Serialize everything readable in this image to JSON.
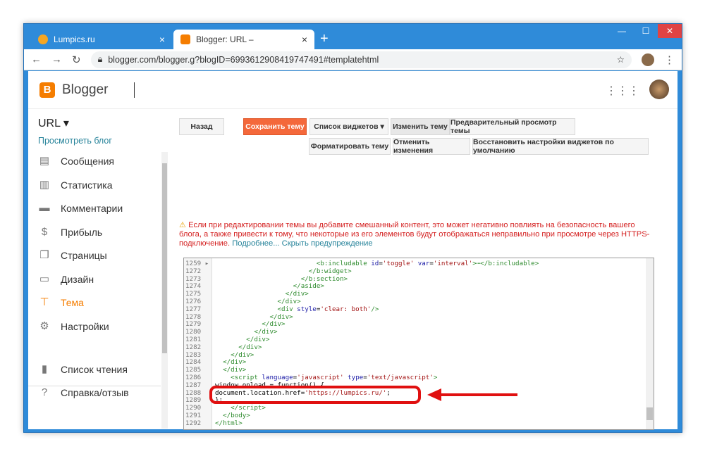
{
  "browser": {
    "tabs": [
      {
        "title": "Lumpics.ru",
        "close": "×"
      },
      {
        "title": "Blogger: URL –",
        "close": "×"
      }
    ],
    "new_tab": "+",
    "url": "blogger.com/blogger.g?blogID=6993612908419747491#templatehtml",
    "controls": [
      "—",
      "☐",
      "✕"
    ]
  },
  "header": {
    "logo": "B",
    "title": "Blogger"
  },
  "sidebar": {
    "blog": "URL ▾",
    "view_blog": "Просмотреть блог",
    "items": [
      {
        "label": "Сообщения",
        "icon": "posts-icon",
        "glyph": "▤"
      },
      {
        "label": "Статистика",
        "icon": "stats-icon",
        "glyph": "▥"
      },
      {
        "label": "Комментарии",
        "icon": "comments-icon",
        "glyph": "▬"
      },
      {
        "label": "Прибыль",
        "icon": "earnings-icon",
        "glyph": "$"
      },
      {
        "label": "Страницы",
        "icon": "pages-icon",
        "glyph": "❐"
      },
      {
        "label": "Дизайн",
        "icon": "layout-icon",
        "glyph": "▭"
      },
      {
        "label": "Тема",
        "icon": "theme-icon",
        "glyph": "⊤"
      },
      {
        "label": "Настройки",
        "icon": "settings-icon",
        "glyph": "⚙"
      }
    ],
    "bottom": [
      {
        "label": "Список чтения",
        "icon": "bookmark-icon",
        "glyph": "▮"
      },
      {
        "label": "Справка/отзыв",
        "icon": "help-icon",
        "glyph": "?"
      }
    ]
  },
  "toolbar": {
    "back": "Назад",
    "save": "Сохранить тему",
    "widgets": "Список виджетов ▾",
    "edit": "Изменить тему",
    "preview": "Предварительный просмотр темы",
    "format": "Форматировать тему",
    "undo": "Отменить изменения",
    "restore": "Восстановить настройки виджетов по умолчанию"
  },
  "warning": {
    "text": "Если при редактировании темы вы добавите смешанный контент, это может негативно повлиять на безопасность вашего блога, а также привести к тому, что некоторые из его элементов будут отображаться неправильно при просмотре через HTTPS-подключение.",
    "more": "Подробнее...",
    "hide": "Скрыть предупреждение"
  },
  "code": [
    {
      "n": "1259 ▸",
      "parts": [
        [
          "t",
          "                          <b:includable "
        ],
        [
          "a",
          "id"
        ],
        [
          "p",
          "="
        ],
        [
          "v",
          "'toggle'"
        ],
        [
          "p",
          " "
        ],
        [
          "a",
          "var"
        ],
        [
          "p",
          "="
        ],
        [
          "v",
          "'interval'"
        ],
        [
          "t",
          ">⋯</b:includable>"
        ]
      ]
    },
    {
      "n": "1272",
      "parts": [
        [
          "t",
          "                        </b:widget>"
        ]
      ]
    },
    {
      "n": "1273",
      "parts": [
        [
          "t",
          "                      </b:section>"
        ]
      ]
    },
    {
      "n": "1274",
      "parts": [
        [
          "t",
          "                    </aside>"
        ]
      ]
    },
    {
      "n": "1275",
      "parts": [
        [
          "t",
          "                  </div>"
        ]
      ]
    },
    {
      "n": "1276",
      "parts": [
        [
          "t",
          "                </div>"
        ]
      ]
    },
    {
      "n": "1277",
      "parts": [
        [
          "t",
          "                <div "
        ],
        [
          "a",
          "style"
        ],
        [
          "p",
          "="
        ],
        [
          "v",
          "'clear: both'"
        ],
        [
          "t",
          "/>"
        ]
      ]
    },
    {
      "n": "1278",
      "parts": [
        [
          "t",
          "              </div>"
        ]
      ]
    },
    {
      "n": "1279",
      "parts": [
        [
          "t",
          "            </div>"
        ]
      ]
    },
    {
      "n": "1280",
      "parts": [
        [
          "t",
          "          </div>"
        ]
      ]
    },
    {
      "n": "1281",
      "parts": [
        [
          "t",
          "        </div>"
        ]
      ]
    },
    {
      "n": "1282",
      "parts": [
        [
          "t",
          "      </div>"
        ]
      ]
    },
    {
      "n": "1283",
      "parts": [
        [
          "t",
          "    </div>"
        ]
      ]
    },
    {
      "n": "1284",
      "parts": [
        [
          "t",
          "  </div>"
        ]
      ]
    },
    {
      "n": "1285",
      "parts": [
        [
          "t",
          "  </div>"
        ]
      ]
    },
    {
      "n": "1286",
      "parts": [
        [
          "t",
          "    <script "
        ],
        [
          "a",
          "language"
        ],
        [
          "p",
          "="
        ],
        [
          "v",
          "'javascript'"
        ],
        [
          "p",
          " "
        ],
        [
          "a",
          "type"
        ],
        [
          "p",
          "="
        ],
        [
          "v",
          "'text/javascript'"
        ],
        [
          "t",
          ">"
        ]
      ]
    },
    {
      "n": "1287",
      "parts": [
        [
          "p",
          "window.onload = function() {"
        ]
      ]
    },
    {
      "n": "1288",
      "parts": [
        [
          "p",
          "document.location.href="
        ],
        [
          "v",
          "'https://lumpics.ru/'"
        ],
        [
          "p",
          ";"
        ]
      ]
    },
    {
      "n": "1289",
      "parts": [
        [
          "p",
          "};"
        ]
      ]
    },
    {
      "n": "1290",
      "parts": [
        [
          "t",
          "    </script>"
        ]
      ]
    },
    {
      "n": "1291",
      "parts": [
        [
          "t",
          "  </body>"
        ]
      ]
    },
    {
      "n": "1292",
      "parts": [
        [
          "t",
          "</html>"
        ]
      ]
    }
  ]
}
